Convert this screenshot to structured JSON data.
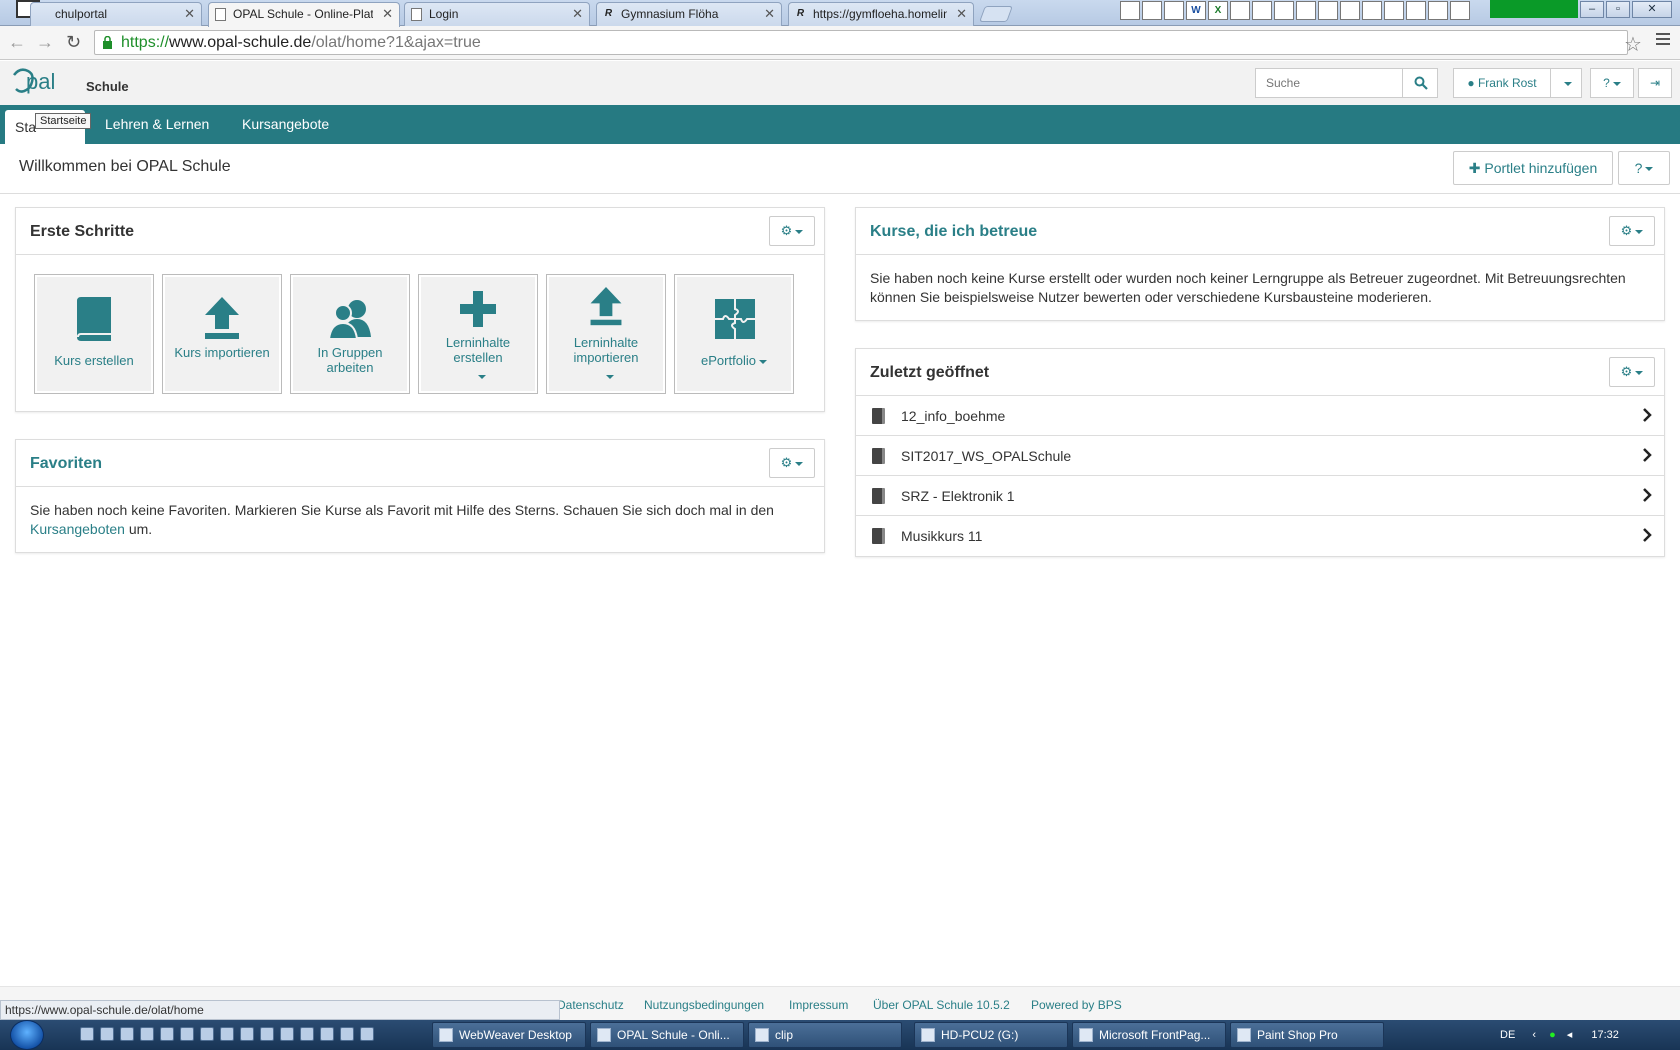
{
  "browser": {
    "tabs": [
      {
        "title": "chulportal",
        "active": false
      },
      {
        "title": "OPAL Schule - Online-Plattform",
        "active": true
      },
      {
        "title": "Login",
        "active": false
      },
      {
        "title": "Gymnasium Flöha",
        "active": false
      },
      {
        "title": "https://gymfloeha.homelinux",
        "active": false
      }
    ],
    "url_scheme": "https://",
    "url_host": "www.opal-schule.de",
    "url_path": "/olat/home?1&ajax=true"
  },
  "header": {
    "logo_text": "OPAL",
    "logo_sub": "Schule",
    "search_placeholder": "Suche",
    "user_name": "Frank Rost"
  },
  "nav": {
    "tabs": [
      {
        "label": "Sta",
        "active": true
      },
      {
        "label": "Lehren & Lernen",
        "active": false
      },
      {
        "label": "Kursangebote",
        "active": false
      }
    ],
    "tooltip": "Startseite"
  },
  "page": {
    "title": "Willkommen bei OPAL Schule",
    "add_portlet_label": "Portlet hinzufügen"
  },
  "erste_schritte": {
    "title": "Erste Schritte",
    "tiles": [
      {
        "label": "Kurs erstellen",
        "icon": "book-icon",
        "dropdown": false
      },
      {
        "label": "Kurs importieren",
        "icon": "upload-icon",
        "dropdown": false
      },
      {
        "label": "In Gruppen arbeiten",
        "icon": "group-icon",
        "dropdown": false
      },
      {
        "label": "Lerninhalte erstellen",
        "icon": "plus-icon",
        "dropdown": true
      },
      {
        "label": "Lerninhalte importieren",
        "icon": "upload-icon",
        "dropdown": true
      },
      {
        "label": "ePortfolio",
        "icon": "puzzle-icon",
        "dropdown": true
      }
    ]
  },
  "favoriten": {
    "title": "Favoriten",
    "text_before": "Sie haben noch keine Favoriten. Markieren Sie Kurse als Favorit mit Hilfe des Sterns. Schauen Sie sich doch mal in den ",
    "link": "Kursangeboten",
    "text_after": " um."
  },
  "kurse": {
    "title": "Kurse, die ich betreue",
    "text": "Sie haben noch keine Kurse erstellt oder wurden noch keiner Lerngruppe als Betreuer zugeordnet. Mit Betreuungsrechten können Sie beispielsweise Nutzer bewerten oder verschiedene Kursbausteine moderieren."
  },
  "zuletzt": {
    "title": "Zuletzt geöffnet",
    "items": [
      "12_info_boehme",
      "SIT2017_WS_OPALSchule",
      "SRZ - Elektronik 1",
      "Musikkurs 11"
    ]
  },
  "footer": {
    "links": [
      "Datenschutz",
      "Nutzungsbedingungen",
      "Impressum",
      "Über OPAL Schule 10.5.2",
      "Powered by BPS"
    ],
    "status_url": "https://www.opal-schule.de/olat/home"
  },
  "taskbar": {
    "buttons": [
      "WebWeaver Desktop",
      "OPAL Schule - Onli...",
      "clip",
      "HD-PCU2 (G:)",
      "Microsoft FrontPag...",
      "Paint Shop Pro"
    ],
    "lang": "DE",
    "time": "17:32"
  },
  "colors": {
    "teal": "#267a82",
    "link": "#2a7f87",
    "url_host_green": "#1e8f2a"
  }
}
